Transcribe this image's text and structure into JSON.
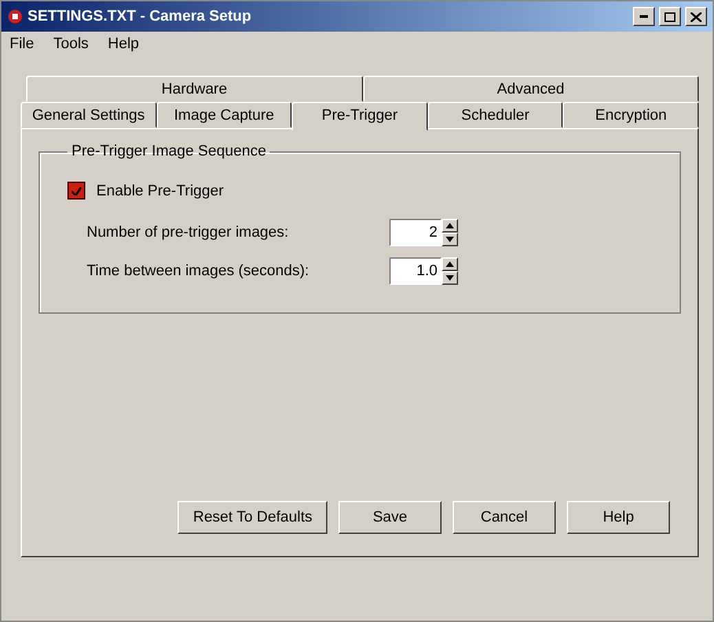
{
  "window": {
    "title": "SETTINGS.TXT - Camera Setup"
  },
  "menu": [
    "File",
    "Tools",
    "Help"
  ],
  "tab_rows": [
    [
      {
        "label": "Hardware",
        "selected": false
      },
      {
        "label": "Advanced",
        "selected": false
      }
    ],
    [
      {
        "label": "General Settings",
        "selected": false
      },
      {
        "label": "Image Capture",
        "selected": false
      },
      {
        "label": "Pre-Trigger",
        "selected": true
      },
      {
        "label": "Scheduler",
        "selected": false
      },
      {
        "label": "Encryption",
        "selected": false
      }
    ]
  ],
  "group": {
    "title": "Pre-Trigger Image Sequence",
    "checkbox": {
      "label": "Enable Pre-Trigger",
      "checked": true
    },
    "fields": [
      {
        "label": "Number of pre-trigger images:",
        "value": "2"
      },
      {
        "label": "Time between images (seconds):",
        "value": "1.0"
      }
    ]
  },
  "buttons": [
    "Reset To Defaults",
    "Save",
    "Cancel",
    "Help"
  ]
}
